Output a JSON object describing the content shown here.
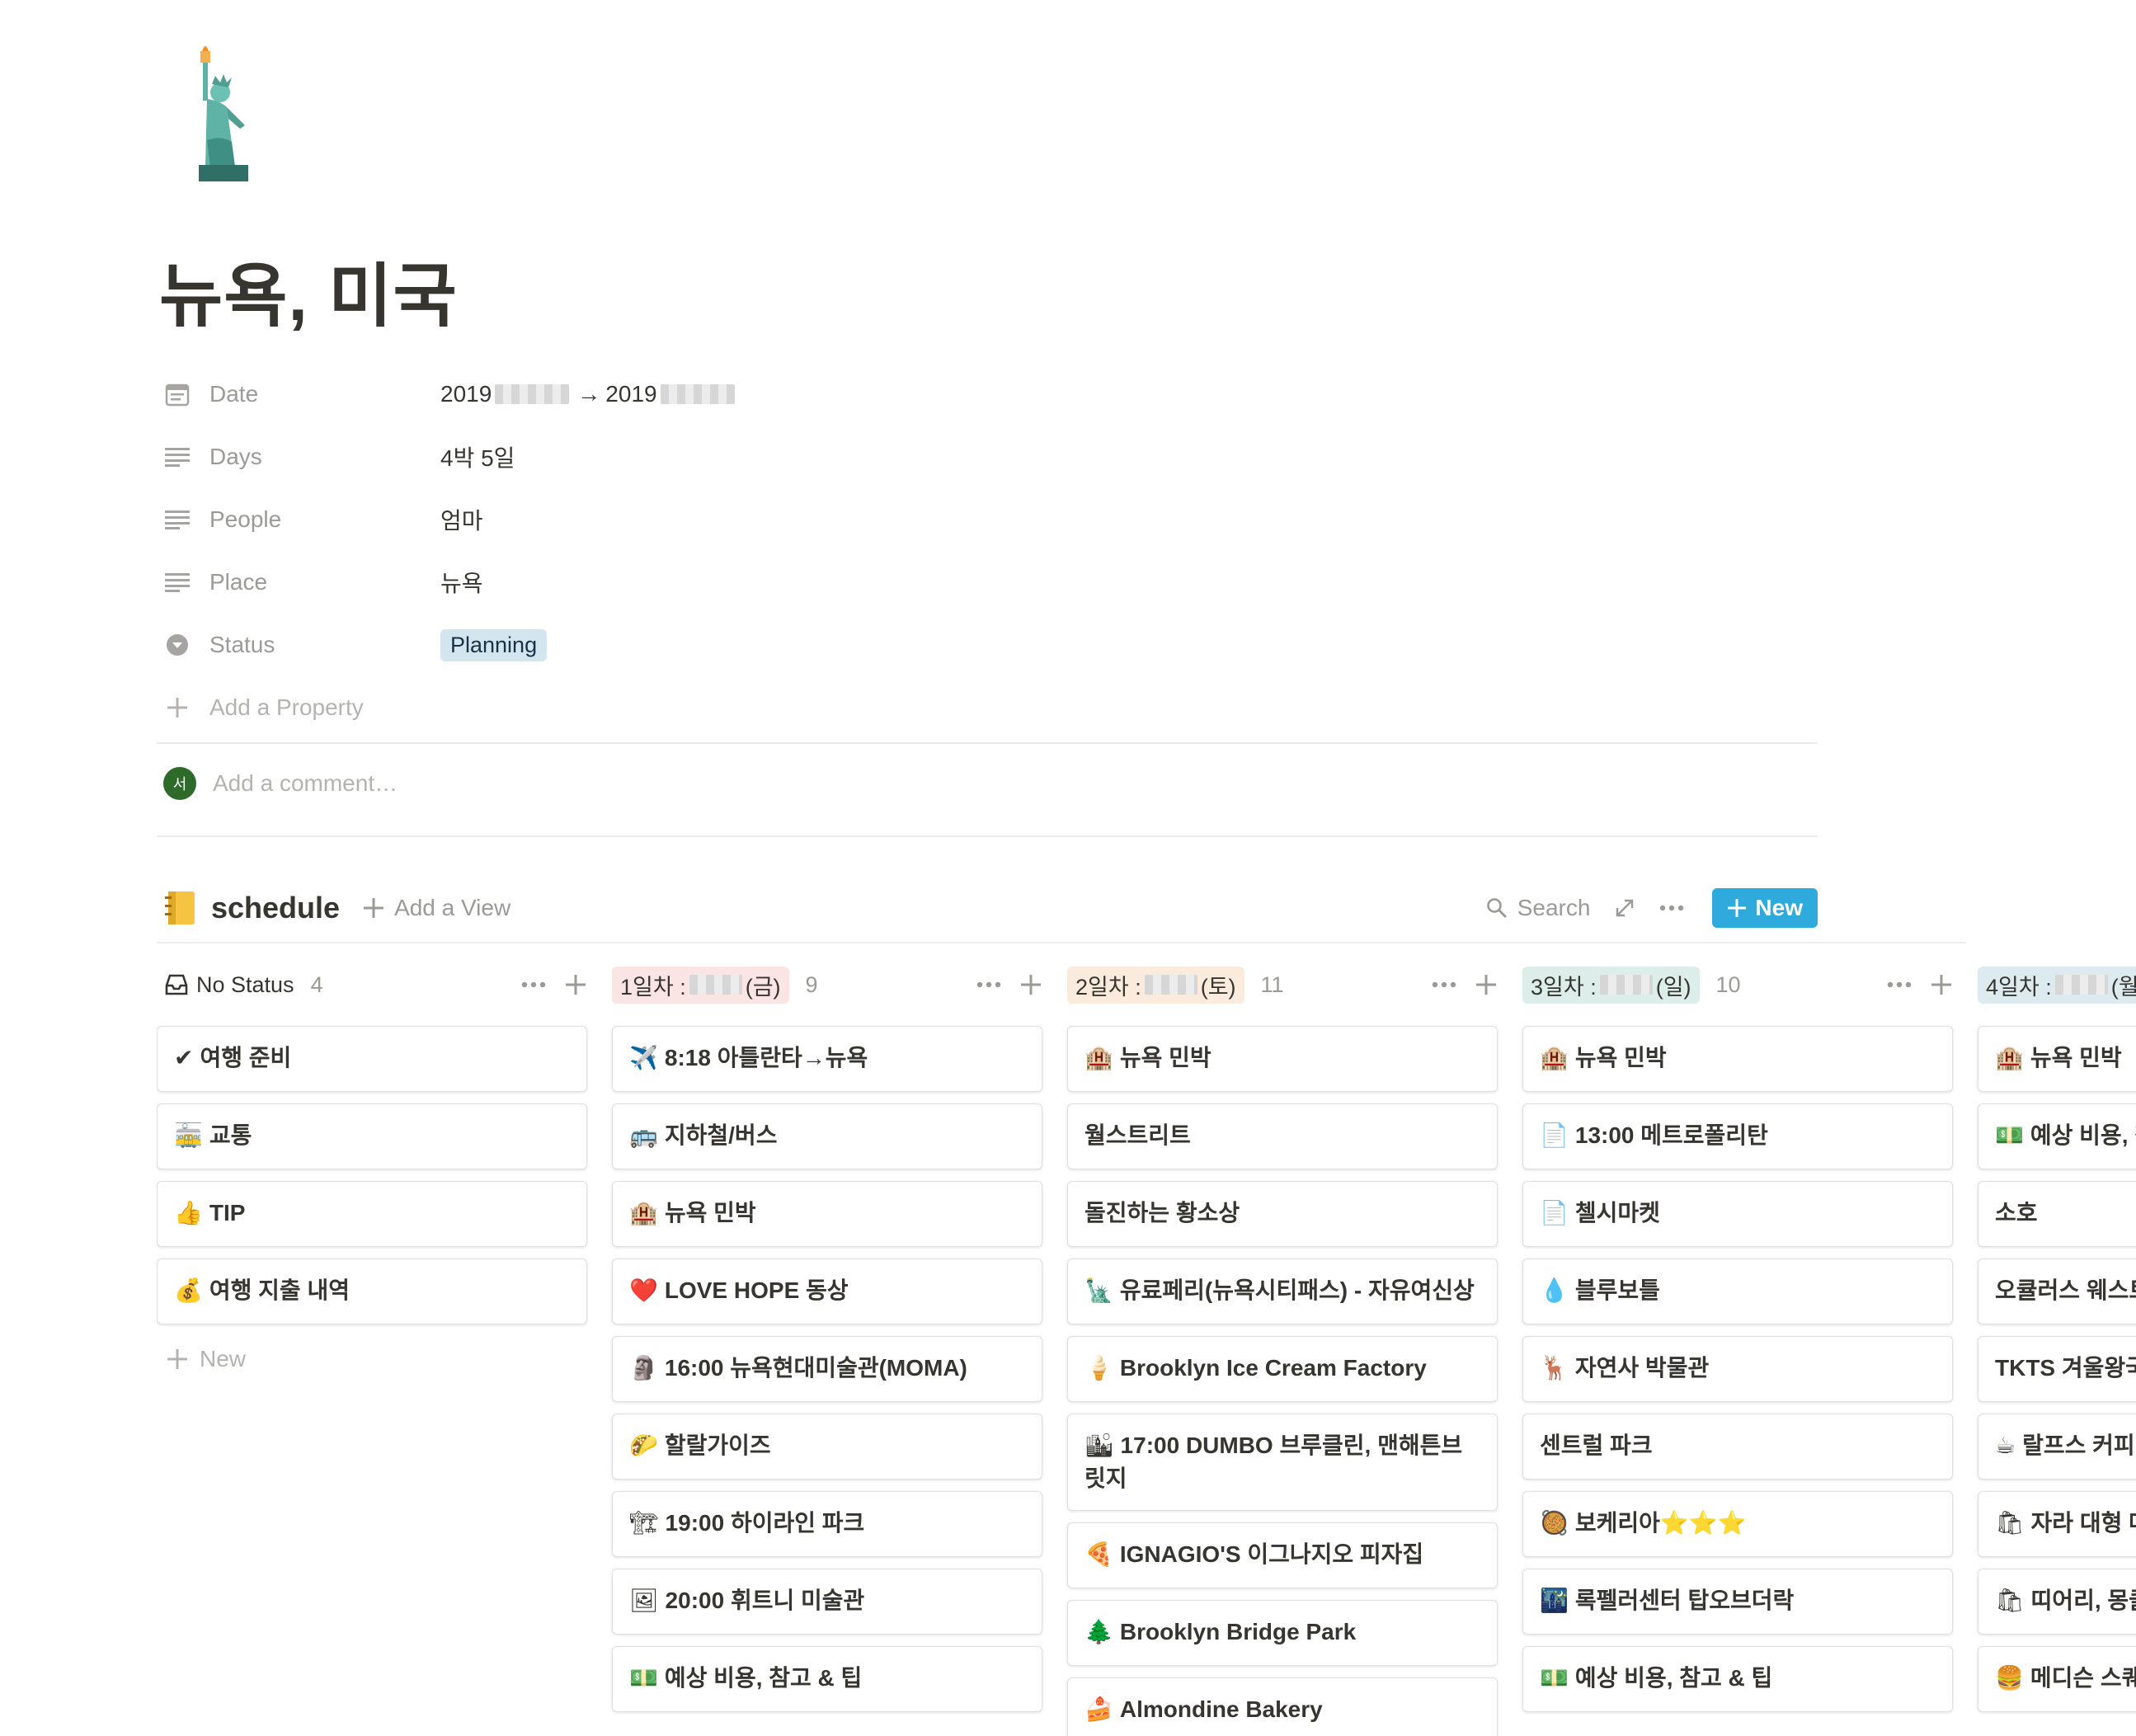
{
  "page": {
    "icon": "statue-of-liberty",
    "title": "뉴욕, 미국"
  },
  "properties": {
    "date": {
      "label": "Date",
      "start": "2019",
      "end": "2019",
      "arrow": "→"
    },
    "days": {
      "label": "Days",
      "value": "4박 5일"
    },
    "people": {
      "label": "People",
      "value": "엄마"
    },
    "place": {
      "label": "Place",
      "value": "뉴욕"
    },
    "status": {
      "label": "Status",
      "value": "Planning",
      "color": "#d3e5ef"
    },
    "add_property": "Add a Property"
  },
  "comment": {
    "avatar_initial": "서",
    "placeholder": "Add a comment…"
  },
  "database": {
    "icon": "notebook-icon",
    "title": "schedule",
    "add_view": "Add a View",
    "search": "Search",
    "new_button": "New",
    "accent": "#2eaadc"
  },
  "columns": [
    {
      "title": "No Status",
      "count": "4",
      "cards": [
        {
          "emoji": "✔",
          "text": "여행 준비"
        },
        {
          "emoji": "🚋",
          "text": "교통"
        },
        {
          "emoji": "👍",
          "text": "TIP"
        },
        {
          "emoji": "💰",
          "text": "여행 지출 내역"
        }
      ],
      "new_label": "New"
    },
    {
      "title_prefix": "1일차 : ",
      "title_suffix": "(금)",
      "count": "9",
      "cards": [
        {
          "emoji": "✈️",
          "text": "8:18 아틀란타→뉴욕"
        },
        {
          "emoji": "🚌",
          "text": "지하철/버스"
        },
        {
          "emoji": "🏨",
          "text": "뉴욕 민박"
        },
        {
          "emoji": "❤️",
          "text": "LOVE HOPE 동상"
        },
        {
          "emoji": "🗿",
          "text": "16:00 뉴욕현대미술관(MOMA)"
        },
        {
          "emoji": "🌮",
          "text": "할랄가이즈"
        },
        {
          "emoji": "🏗",
          "text": "19:00 하이라인 파크"
        },
        {
          "emoji": "🖼",
          "text": "20:00 휘트니 미술관"
        },
        {
          "emoji": "💵",
          "text": "예상 비용, 참고 & 팁"
        }
      ]
    },
    {
      "title_prefix": "2일차 : ",
      "title_suffix": "(토)",
      "count": "11",
      "cards": [
        {
          "emoji": "🏨",
          "text": "뉴욕 민박"
        },
        {
          "emoji": "",
          "text": "월스트리트"
        },
        {
          "emoji": "",
          "text": "돌진하는 황소상"
        },
        {
          "emoji": "🗽",
          "text": "유료페리(뉴욕시티패스) - 자유여신상"
        },
        {
          "emoji": "🍦",
          "text": "Brooklyn Ice Cream Factory"
        },
        {
          "emoji": "🏙",
          "text": "17:00 DUMBO 브루클린, 맨해튼브릿지"
        },
        {
          "emoji": "🍕",
          "text": "IGNAGIO'S 이그나지오 피자집"
        },
        {
          "emoji": "🌲",
          "text": "Brooklyn Bridge Park"
        },
        {
          "emoji": "🍰",
          "text": "Almondine Bakery"
        }
      ]
    },
    {
      "title_prefix": "3일차 : ",
      "title_suffix": "(일)",
      "count": "10",
      "cards": [
        {
          "emoji": "🏨",
          "text": "뉴욕 민박"
        },
        {
          "emoji": "📄",
          "text": "13:00 메트로폴리탄"
        },
        {
          "emoji": "📄",
          "text": "첼시마켓"
        },
        {
          "emoji": "💧",
          "text": "블루보틀"
        },
        {
          "emoji": "🦌",
          "text": "자연사 박물관"
        },
        {
          "emoji": "",
          "text": "센트럴 파크"
        },
        {
          "emoji": "🥘",
          "text": "보케리아⭐⭐⭐"
        },
        {
          "emoji": "🌃",
          "text": "록펠러센터 탑오브더락"
        },
        {
          "emoji": "💵",
          "text": "예상 비용, 참고 & 팁"
        }
      ]
    },
    {
      "title_prefix": "4일차 : ",
      "title_suffix": "(월",
      "count": "",
      "cards": [
        {
          "emoji": "🏨",
          "text": "뉴욕 민박"
        },
        {
          "emoji": "💵",
          "text": "예상 비용, 참"
        },
        {
          "emoji": "",
          "text": "소호"
        },
        {
          "emoji": "",
          "text": "오큘러스 웨스트"
        },
        {
          "emoji": "",
          "text": "TKTS 겨울왕국"
        },
        {
          "emoji": "☕",
          "text": "랄프스 커피"
        },
        {
          "emoji": "🛍",
          "text": "자라 대형 매"
        },
        {
          "emoji": "🛍",
          "text": "띠어리, 몽클"
        },
        {
          "emoji": "🍔",
          "text": "메디슨 스퀘어"
        }
      ]
    }
  ]
}
